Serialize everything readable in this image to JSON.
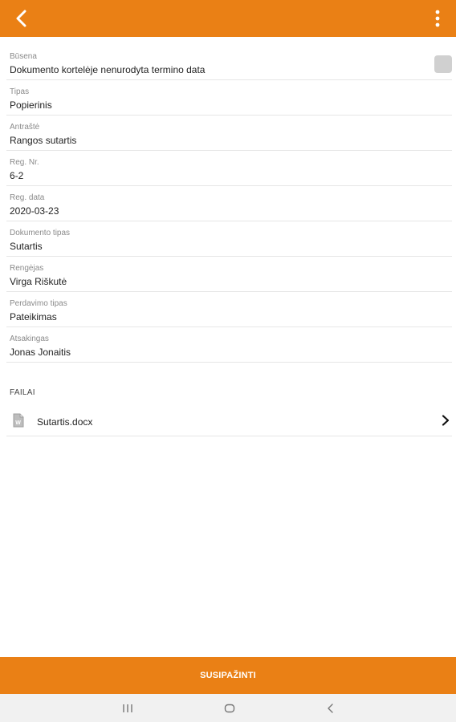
{
  "header": {
    "back_icon": "chevron-left-icon",
    "menu_icon": "more-vertical-icon",
    "color": "#ea8015"
  },
  "fields": [
    {
      "label": "Būsena",
      "value": "Dokumento kortelėje nenurodyta termino data"
    },
    {
      "label": "Tipas",
      "value": "Popierinis"
    },
    {
      "label": "Antraštė",
      "value": "Rangos sutartis"
    },
    {
      "label": "Reg. Nr.",
      "value": "6-2"
    },
    {
      "label": "Reg. data",
      "value": "2020-03-23"
    },
    {
      "label": "Dokumento tipas",
      "value": "Sutartis"
    },
    {
      "label": "Rengėjas",
      "value": "Virga Riškutė"
    },
    {
      "label": "Perdavimo tipas",
      "value": "Pateikimas"
    },
    {
      "label": "Atsakingas",
      "value": "Jonas Jonaitis"
    }
  ],
  "files": {
    "title": "FAILAI",
    "items": [
      {
        "name": "Sutartis.docx",
        "icon": "word-document-icon"
      }
    ]
  },
  "footer": {
    "action_label": "SUSIPAŽINTI"
  },
  "system_nav": {
    "recents_icon": "recents-icon",
    "home_icon": "home-icon",
    "back_icon": "back-icon"
  }
}
